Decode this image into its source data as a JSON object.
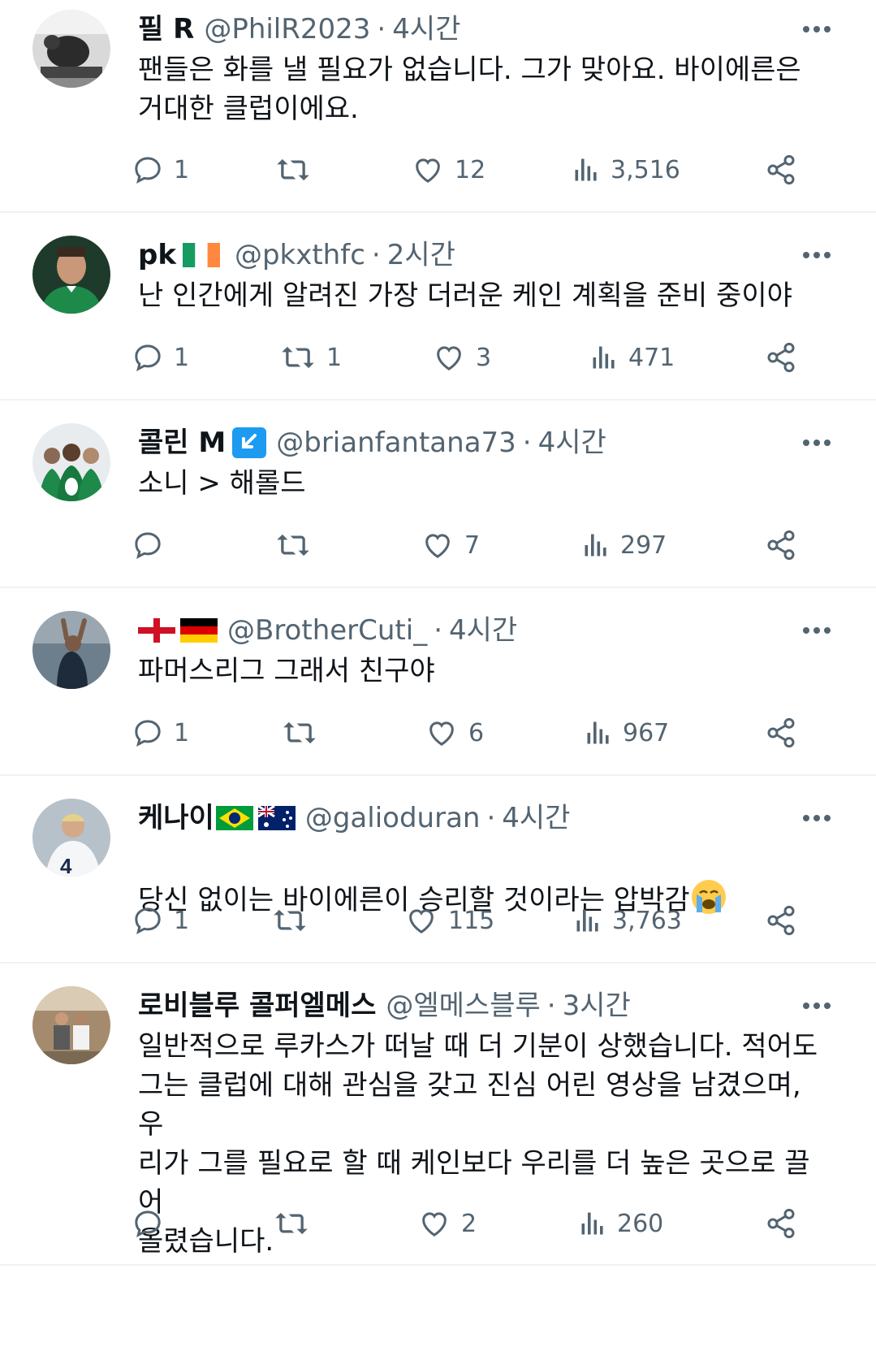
{
  "tweets": [
    {
      "name": "필 R",
      "handle": "@PhilR2023",
      "sep": "·",
      "time": "4시간",
      "text": "팬들은 화를 낼 필요가 없습니다. 그가 맞아요. 바이에른은\n거대한 클럽이에요.",
      "replies": "1",
      "retweets": "",
      "likes": "12",
      "views": "3,516"
    },
    {
      "name": "pk",
      "flags": [
        "ireland-flag"
      ],
      "handle": "@pkxthfc",
      "sep": "·",
      "time": "2시간",
      "text": "난 인간에게 알려진 가장 더러운 케인 계획을 준비 중이야",
      "replies": "1",
      "retweets": "1",
      "likes": "3",
      "views": "471"
    },
    {
      "name": "콜린 M",
      "badge_icon": "arrow-down-left-badge-icon",
      "handle": "@brianfantana73",
      "sep": "·",
      "time": "4시간",
      "text": "소니 > 해롤드",
      "replies": "",
      "retweets": "",
      "likes": "7",
      "views": "297"
    },
    {
      "name": "",
      "flags": [
        "england-flag",
        "germany-flag"
      ],
      "handle": "@BrotherCuti_",
      "sep": "·",
      "time": "4시간",
      "text": "파머스리그 그래서 친구야",
      "replies": "1",
      "retweets": "",
      "likes": "6",
      "views": "967"
    },
    {
      "name": "케나이",
      "flags": [
        "brazil-flag",
        "australia-flag"
      ],
      "handle": "@galioduran",
      "sep": "·",
      "time": "4시간",
      "text": "당신 없이는 바이에른이 승리할 것이라는 압박감",
      "emoji": "loudly-crying-face-emoji",
      "replies": "1",
      "retweets": "",
      "likes": "115",
      "views": "3,763"
    },
    {
      "name": "로비블루 콜퍼엘메스",
      "handle": "@엘메스블루",
      "sep": "·",
      "time": "3시간",
      "text": "일반적으로 루카스가 떠날 때 더 기분이 상했습니다. 적어도\n그는 클럽에 대해 관심을 갖고 진심 어린 영상을 남겼으며, 우\n리가 그를 필요로 할 때 케인보다 우리를 더 높은 곳으로 끌어\n올렸습니다.",
      "replies": "",
      "retweets": "",
      "likes": "2",
      "views": "260"
    }
  ],
  "colors": {
    "text": "#0f1419",
    "secondary": "#536471",
    "divider": "#eff3f4",
    "badge_blue": "#1d9bf0"
  },
  "icons": {
    "reply": "speech-bubble-icon",
    "retweet": "retweet-arrows-icon",
    "like": "heart-icon",
    "views": "bar-chart-icon",
    "share": "share-nodes-icon",
    "more": "three-dots-icon"
  }
}
